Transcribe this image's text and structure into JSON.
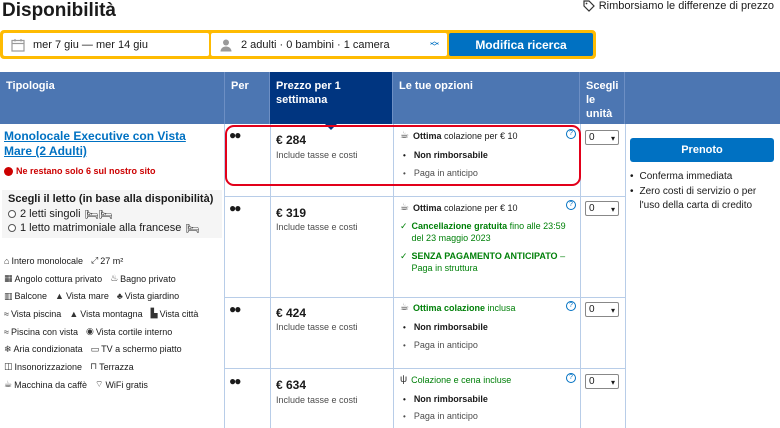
{
  "header": {
    "title": "Disponibilità",
    "price_match": "Rimborsiamo le differenze di prezzo"
  },
  "search": {
    "dates": "mer 7 giu — mer 14 giu",
    "guests": "2 adulti · 0 bambini · 1 camera",
    "button": "Modifica ricerca"
  },
  "table": {
    "headers": {
      "tipologia": "Tipologia",
      "per": "Per",
      "prezzo": "Prezzo per 1 settimana",
      "opzioni": "Le tue opzioni",
      "scegli": "Scegli le unità"
    }
  },
  "room": {
    "title": "Monolocale Executive con Vista Mare (2 Adulti)",
    "scarcity": "Ne restano solo 6 sul nostro sito",
    "bed_title": "Scegli il letto (in base alla disponibilità)",
    "bed_options": [
      "2 letti singoli",
      "1 letto matrimoniale alla francese"
    ],
    "facilities": [
      [
        "Intero monolocale",
        "27 m²"
      ],
      [
        "Angolo cottura privato",
        "Bagno privato"
      ],
      [
        "Balcone",
        "Vista mare",
        "Vista giardino"
      ],
      [
        "Vista piscina",
        "Vista montagna",
        "Vista città"
      ],
      [
        "Piscina con vista",
        "Vista cortile interno"
      ],
      [
        "Aria condizionata",
        "TV a schermo piatto"
      ],
      [
        "Insonorizzazione",
        "Terrazza"
      ],
      [
        "Macchina da caffè",
        "WiFi gratis"
      ]
    ]
  },
  "rows": [
    {
      "price": "€ 284",
      "price_note": "Include tasse e costi",
      "meal_bold": "Ottima",
      "meal_rest": "colazione per € 10",
      "line2": "Non rimborsabile",
      "line3": "Paga in anticipo",
      "qty": "0"
    },
    {
      "price": "€ 319",
      "price_note": "Include tasse e costi",
      "meal_bold": "Ottima",
      "meal_rest": "colazione per € 10",
      "line2_green": "Cancellazione gratuita",
      "line2_rest": "fino alle 23:59 del 23 maggio 2023",
      "line3_green": "SENZA PAGAMENTO ANTICIPATO",
      "line3_rest": "– Paga in struttura",
      "qty": "0"
    },
    {
      "price": "€ 424",
      "price_note": "Include tasse e costi",
      "meal_bold": "Ottima colazione",
      "meal_rest": "inclusa",
      "line2": "Non rimborsabile",
      "line3": "Paga in anticipo",
      "qty": "0"
    },
    {
      "price": "€ 634",
      "price_note": "Include tasse e costi",
      "meal_bold": "",
      "meal_rest": "Colazione e cena incluse",
      "line2": "Non rimborsabile",
      "line3": "Paga in anticipo",
      "qty": "0"
    }
  ],
  "actions": {
    "reserve": "Prenoto",
    "benefits": [
      "Conferma immediata",
      "Zero costi di servizio o per l'uso della carta di credito"
    ]
  },
  "colors": {
    "brand_blue": "#0071c2",
    "header_blue": "#4c76b2",
    "header_selected": "#003580",
    "accent_yellow": "#febb02",
    "green": "#008009",
    "highlight_red": "#e2001a"
  }
}
